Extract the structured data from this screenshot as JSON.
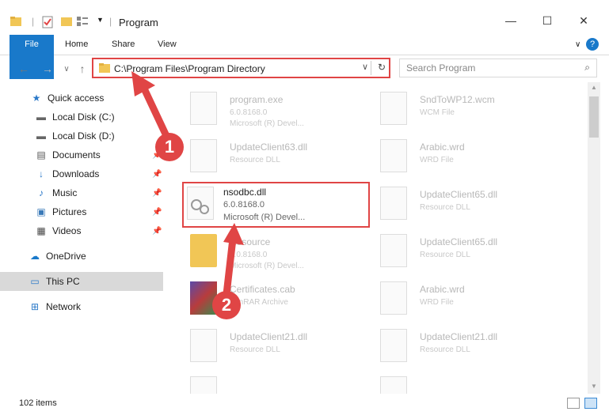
{
  "window": {
    "title": "Program",
    "minimize": "—",
    "maximize": "☐",
    "close": "✕"
  },
  "ribbon": {
    "tabs": [
      "File",
      "Home",
      "Share",
      "View"
    ],
    "help": "?"
  },
  "address": {
    "path": "C:\\Program Files\\Program Directory",
    "dropdown": "∨",
    "refresh": "↻"
  },
  "search": {
    "placeholder": "Search Program",
    "icon": "⌕"
  },
  "nav": {
    "back": "←",
    "forward": "→",
    "recent": "∨",
    "up": "↑"
  },
  "sidebar": {
    "items": [
      {
        "label": "Quick access",
        "icon": "★"
      },
      {
        "label": "Local Disk (C:)",
        "icon": "▬"
      },
      {
        "label": "Local Disk (D:)",
        "icon": "▬"
      },
      {
        "label": "Documents",
        "icon": "▤"
      },
      {
        "label": "Downloads",
        "icon": "↓"
      },
      {
        "label": "Music",
        "icon": "♪"
      },
      {
        "label": "Pictures",
        "icon": "▣"
      },
      {
        "label": "Videos",
        "icon": "▦"
      },
      {
        "label": "OneDrive",
        "icon": "☁"
      },
      {
        "label": "This PC",
        "icon": "▭"
      },
      {
        "label": "Network",
        "icon": "⊞"
      }
    ]
  },
  "files": [
    {
      "name": "program.exe",
      "l2": "6.0.8168.0",
      "l3": "Microsoft (R) Devel..."
    },
    {
      "name": "SndToWP12.wcm",
      "l2": "WCM File",
      "l3": ""
    },
    {
      "name": "UpdateClient63.dll",
      "l2": "Resource DLL",
      "l3": ""
    },
    {
      "name": "Arabic.wrd",
      "l2": "WRD File",
      "l3": ""
    },
    {
      "name": "nsodbc.dll",
      "l2": "6.0.8168.0",
      "l3": "Microsoft (R) Devel..."
    },
    {
      "name": "UpdateClient65.dll",
      "l2": "Resource DLL",
      "l3": ""
    },
    {
      "name": "Resource",
      "l2": "6.0.8168.0",
      "l3": "Microsoft (R) Devel..."
    },
    {
      "name": "UpdateClient65.dll",
      "l2": "Resource DLL",
      "l3": ""
    },
    {
      "name": "Certificates.cab",
      "l2": "WinRAR Archive",
      "l3": ""
    },
    {
      "name": "Arabic.wrd",
      "l2": "WRD File",
      "l3": ""
    },
    {
      "name": "UpdateClient21.dll",
      "l2": "Resource DLL",
      "l3": ""
    },
    {
      "name": "UpdateClient21.dll",
      "l2": "Resource DLL",
      "l3": ""
    }
  ],
  "status": {
    "item_count": "102 items"
  },
  "annotations": {
    "step1": "1",
    "step2": "2",
    "color": "#e04545"
  }
}
